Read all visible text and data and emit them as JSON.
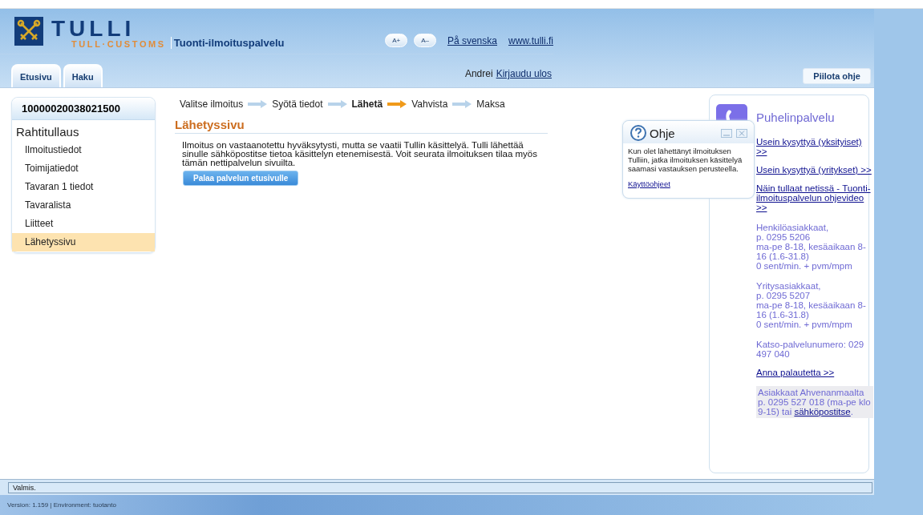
{
  "header": {
    "logo_name": "TULLI",
    "logo_subtitle": "TULL·CUSTOMS",
    "service_title": "Tuonti-ilmoituspalvelu",
    "font_buttons": [
      "A+",
      "A–"
    ],
    "links": [
      "På svenska",
      "www.tulli.fi"
    ]
  },
  "tabs": [
    {
      "label": "Etusivu",
      "selected": false
    },
    {
      "label": "Haku",
      "selected": false
    }
  ],
  "user": {
    "name": "Andrei",
    "logout": "Kirjaudu ulos"
  },
  "hide_help_button": "Piilota ohje",
  "sidebar": {
    "number": "10000020038021500",
    "title": "Rahtitullaus",
    "items": [
      {
        "label": "Ilmoitustiedot",
        "selected": false
      },
      {
        "label": "Toimijatiedot",
        "selected": false
      },
      {
        "label": "Tavaran 1 tiedot",
        "selected": false
      },
      {
        "label": "Tavaralista",
        "selected": false
      },
      {
        "label": "Liitteet",
        "selected": false
      },
      {
        "label": "Lähetyssivu",
        "selected": true
      }
    ]
  },
  "steps": [
    {
      "label": "Valitse ilmoitus",
      "selected": false
    },
    {
      "label": "Syötä tiedot",
      "selected": false
    },
    {
      "label": "Lähetä",
      "selected": true
    },
    {
      "label": "Vahvista",
      "selected": false
    },
    {
      "label": "Maksa",
      "selected": false
    }
  ],
  "page_title": "Lähetyssivu",
  "message": "Ilmoitus on vastaanotettu hyväksytysti, mutta se vaatii Tullin käsittelyä. Tulli lähettää sinulle sähköpostitse tietoa käsittelyn etenemisestä. Voit seurata ilmoituksen tilaa myös tämän nettipalvelun sivuilta.",
  "back_button": "Palaa palvelun etusivulle",
  "help_popup": {
    "title": "Ohje",
    "text": "Kun olet lähettänyt ilmoituksen Tulliin, jatka ilmoituksen käsittelyä saamasi vastauksen perusteella.",
    "link": "Käyttöohjeet"
  },
  "phone_panel": {
    "title": "Puhelinpalvelu",
    "sections": [
      {
        "kind": "link",
        "text": "Usein kysyttyä (yksityiset) >>"
      },
      {
        "kind": "link",
        "text": "Usein kysyttyä (yritykset) >>"
      },
      {
        "kind": "link",
        "text": "Näin tullaat netissä - Tuonti-ilmoituspalvelun ohjevideo >>"
      },
      {
        "kind": "info",
        "lines": [
          "Henkilöasiakkaat,",
          "p. 0295 5206",
          "ma-pe 8-18, kesäaikaan 8-16 (1.6-31.8)",
          "0 sent/min. + pvm/mpm"
        ]
      },
      {
        "kind": "info",
        "lines": [
          "Yritysasiakkaat,",
          "p. 0295 5207",
          "ma-pe 8-18, kesäaikaan 8-16 (1.6-31.8)",
          "0 sent/min. + pvm/mpm"
        ]
      },
      {
        "kind": "info",
        "lines": [
          "Katso-palvelunumero: 029 497 040"
        ]
      },
      {
        "kind": "link",
        "text": "Anna palautetta >>"
      },
      {
        "kind": "note",
        "text": "Asiakkaat Ahvenanmaalta p. 0295 527 018 (ma-pe klo 9-15) tai",
        "link": "sähköpostitse",
        "after": "."
      }
    ]
  },
  "status_bar": "Valmis.",
  "footer": "Version: 1.159 | Environment: tuotanto"
}
